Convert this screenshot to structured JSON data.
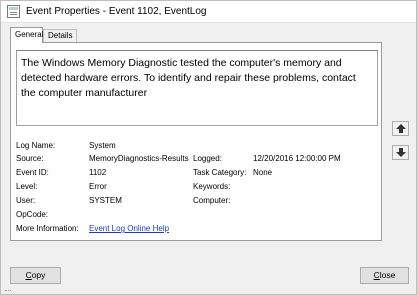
{
  "window": {
    "title": "Event Properties - Event 1102, EventLog"
  },
  "tabs": [
    {
      "label": "General",
      "active": true
    },
    {
      "label": "Details",
      "active": false
    }
  ],
  "event": {
    "description": "The Windows Memory Diagnostic tested the computer's memory and detected hardware errors. To identify and repair these problems, contact the computer manufacturer",
    "fields": {
      "log_name_label": "Log Name:",
      "log_name": "System",
      "source_label": "Source:",
      "source": "MemoryDiagnostics-Results",
      "logged_label": "Logged:",
      "logged": "12/20/2016 12:00:00 PM",
      "event_id_label": "Event ID:",
      "event_id": "1102",
      "task_category_label": "Task Category:",
      "task_category": "None",
      "level_label": "Level:",
      "level": "Error",
      "keywords_label": "Keywords:",
      "keywords": "",
      "user_label": "User:",
      "user": "SYSTEM",
      "computer_label": "Computer:",
      "computer": "",
      "opcode_label": "OpCode:",
      "opcode": "",
      "more_info_label": "More Information:",
      "more_info_link": "Event Log Online Help"
    }
  },
  "buttons": {
    "copy": "Copy",
    "close": "Close"
  },
  "colors": {
    "link": "#1a3cc8",
    "panel_bg": "#ffffff",
    "window_bg": "#f0f0f0"
  },
  "icons": {
    "title": "event-properties-icon",
    "up": "arrow-up-icon",
    "down": "arrow-down-icon"
  }
}
